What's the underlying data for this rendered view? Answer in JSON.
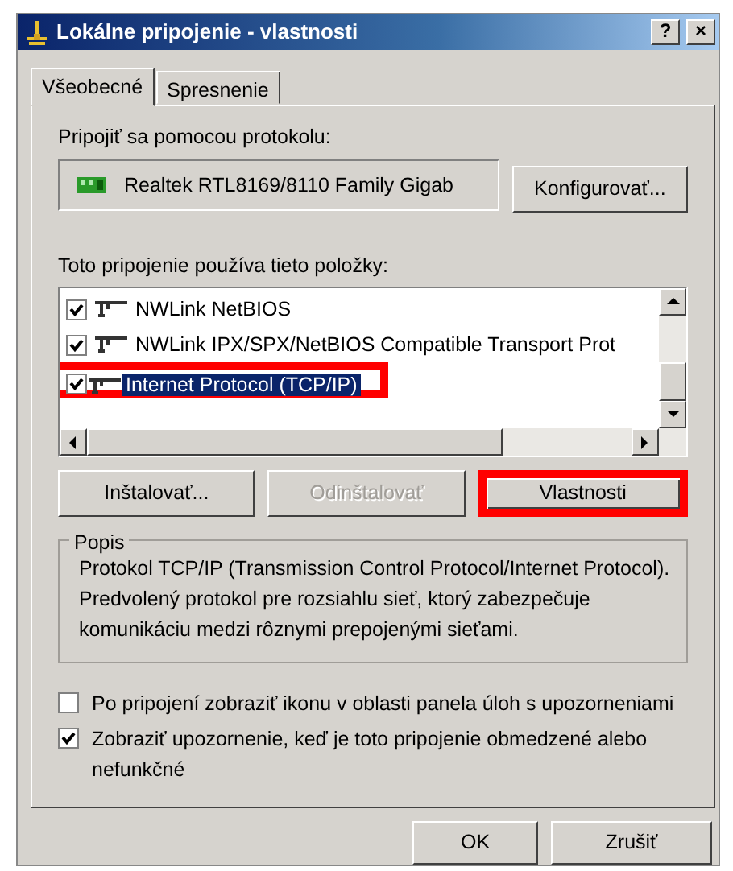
{
  "window": {
    "title": "Lokálne pripojenie - vlastnosti",
    "title_buttons": [
      "?",
      "×"
    ]
  },
  "tabs": [
    {
      "label": "Všeobecné",
      "selected": true
    },
    {
      "label": "Spresnenie",
      "selected": false
    }
  ],
  "connect_using": {
    "label": "Pripojiť sa pomocou protokolu:",
    "adapter": "Realtek RTL8169/8110 Family Gigab",
    "button": "Konfigurovať..."
  },
  "components": {
    "label": "Toto pripojenie používa tieto položky:",
    "items": [
      {
        "name": "NWLink NetBIOS",
        "checked": true,
        "selected": false,
        "highlighted": false
      },
      {
        "name": "NWLink IPX/SPX/NetBIOS Compatible Transport Prot",
        "checked": true,
        "selected": false,
        "highlighted": false
      },
      {
        "name": "Internet Protocol (TCP/IP)",
        "checked": true,
        "selected": true,
        "highlighted": true
      }
    ]
  },
  "buttons": [
    {
      "label": "Inštalovať...",
      "disabled": false,
      "highlighted": false
    },
    {
      "label": "Odinštalovať",
      "disabled": true,
      "highlighted": false
    },
    {
      "label": "Vlastnosti",
      "disabled": false,
      "highlighted": true
    }
  ],
  "description": {
    "title": "Popis",
    "text": "Protokol TCP/IP (Transmission Control Protocol/Internet Protocol). Predvolený protokol pre rozsiahlu sieť, ktorý zabezpečuje komunikáciu medzi rôznymi prepojenými sieťami."
  },
  "options": [
    {
      "label": "Po pripojení zobraziť ikonu v oblasti panela úloh s upozorneniami",
      "checked": false
    },
    {
      "label": "Zobraziť upozornenie, keď je toto pripojenie obmedzené alebo nefunkčné",
      "checked": true
    }
  ],
  "footer_buttons": [
    "OK",
    "Zrušiť"
  ]
}
